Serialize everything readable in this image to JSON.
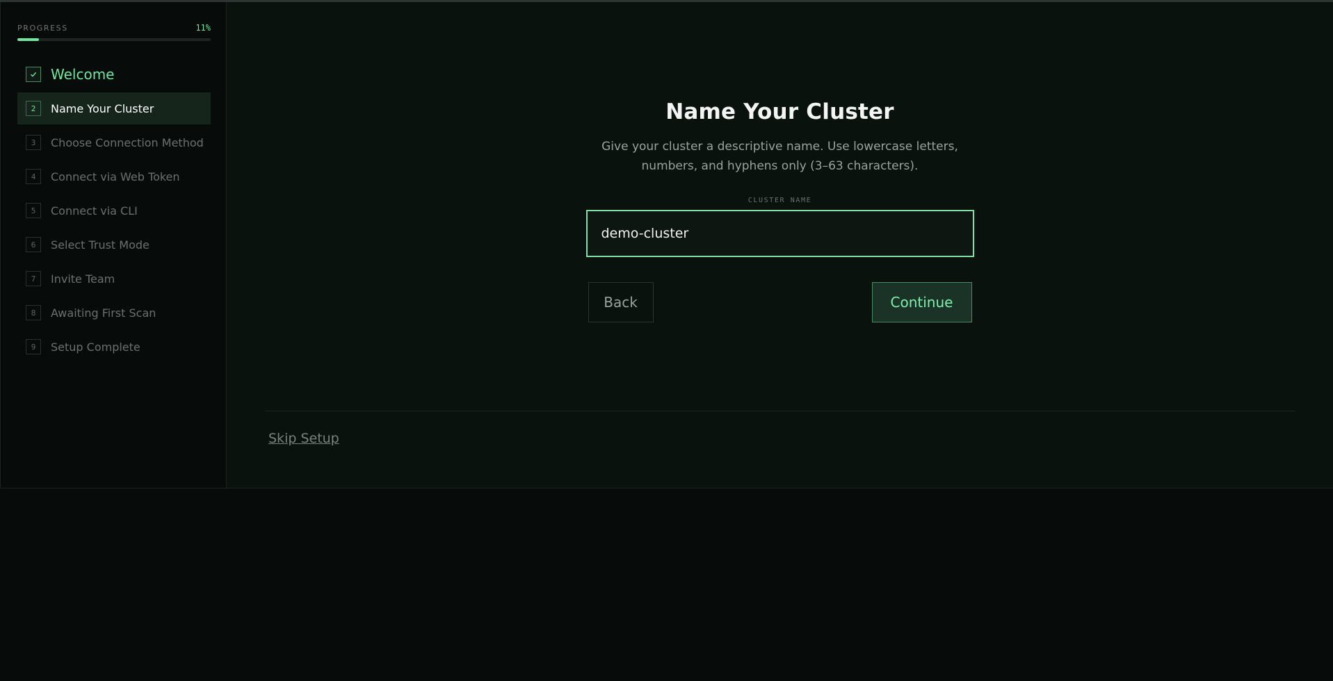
{
  "progress": {
    "label": "PROGRESS",
    "percent_text": "11%",
    "fraction": 0.11
  },
  "steps": [
    {
      "number": "",
      "label": "Welcome",
      "state": "done",
      "icon": "check-icon"
    },
    {
      "number": "2",
      "label": "Name Your Cluster",
      "state": "active"
    },
    {
      "number": "3",
      "label": "Choose Connection Method",
      "state": "pending"
    },
    {
      "number": "4",
      "label": "Connect via Web Token",
      "state": "pending"
    },
    {
      "number": "5",
      "label": "Connect via CLI",
      "state": "pending"
    },
    {
      "number": "6",
      "label": "Select Trust Mode",
      "state": "pending"
    },
    {
      "number": "7",
      "label": "Invite Team",
      "state": "pending"
    },
    {
      "number": "8",
      "label": "Awaiting First Scan",
      "state": "pending"
    },
    {
      "number": "9",
      "label": "Setup Complete",
      "state": "pending"
    }
  ],
  "main": {
    "title": "Name Your Cluster",
    "description": "Give your cluster a descriptive name. Use lowercase letters, numbers, and hyphens only (3–63 characters).",
    "field_label": "CLUSTER NAME",
    "field_value": "demo-cluster",
    "back_label": "Back",
    "continue_label": "Continue",
    "skip_label": "Skip Setup"
  },
  "colors": {
    "accent": "#6fe8a0",
    "background": "#0a120e",
    "sidebar_background": "#070b09",
    "active_step_background": "#15251c"
  }
}
